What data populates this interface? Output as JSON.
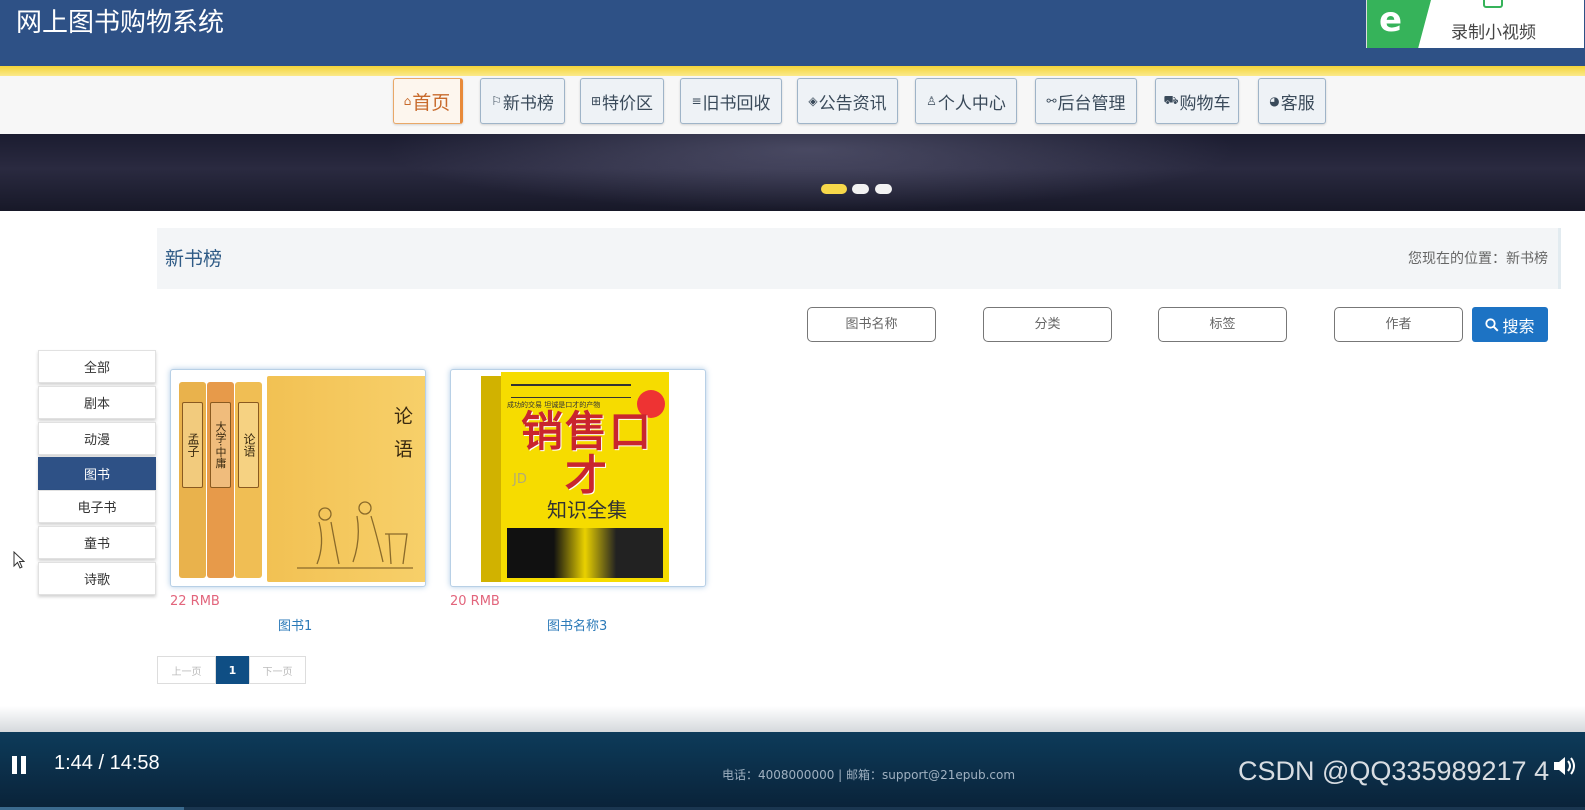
{
  "header": {
    "site_title": "网上图书购物系统",
    "record_label": "录制小视频"
  },
  "nav": {
    "items": [
      {
        "label": "首页",
        "icon": "home-icon",
        "glyph": "⌂",
        "active": true
      },
      {
        "label": "新书榜",
        "icon": "flag-icon",
        "glyph": "⚐"
      },
      {
        "label": "特价区",
        "icon": "grid-icon",
        "glyph": "⊞"
      },
      {
        "label": "旧书回收",
        "icon": "sliders-icon",
        "glyph": "≡"
      },
      {
        "label": "公告资讯",
        "icon": "layers-icon",
        "glyph": "◈"
      },
      {
        "label": "个人中心",
        "icon": "user-icon",
        "glyph": "♙"
      },
      {
        "label": "后台管理",
        "icon": "link-icon",
        "glyph": "⚯"
      },
      {
        "label": "购物车",
        "icon": "cart-icon",
        "glyph": "⛟"
      },
      {
        "label": "客服",
        "icon": "chat-icon",
        "glyph": "◕"
      }
    ]
  },
  "banner": {
    "dots": 3,
    "active_dot": 0
  },
  "breadcrumb": {
    "title": "新书榜",
    "location": "您现在的位置：新书榜"
  },
  "search": {
    "fields": [
      {
        "placeholder": "图书名称"
      },
      {
        "placeholder": "分类"
      },
      {
        "placeholder": "标签"
      },
      {
        "placeholder": "作者"
      }
    ],
    "button_label": "搜索"
  },
  "categories": {
    "items": [
      "全部",
      "剧本",
      "动漫",
      "图书",
      "电子书",
      "童书",
      "诗歌"
    ],
    "active": "图书"
  },
  "books": [
    {
      "name": "图书1",
      "price": "22 RMB",
      "cover": {
        "spines": [
          "孟子",
          "大学·中庸",
          "论语"
        ],
        "title": "论语"
      }
    },
    {
      "name": "图书名称3",
      "price": "20 RMB",
      "cover": {
        "top": "成功的交易 坦诚是口才的产物",
        "big": "销售口才",
        "sub": "知识全集",
        "watermark": "JD"
      }
    }
  ],
  "pagination": {
    "prev": "上一页",
    "current": "1",
    "next": "下一页"
  },
  "player": {
    "time": "1:44 / 14:58",
    "progress": 0.116,
    "footer": "电话：4008000000 | 邮箱：support@21epub.com",
    "watermark": "CSDN @QQ335989217 4"
  }
}
